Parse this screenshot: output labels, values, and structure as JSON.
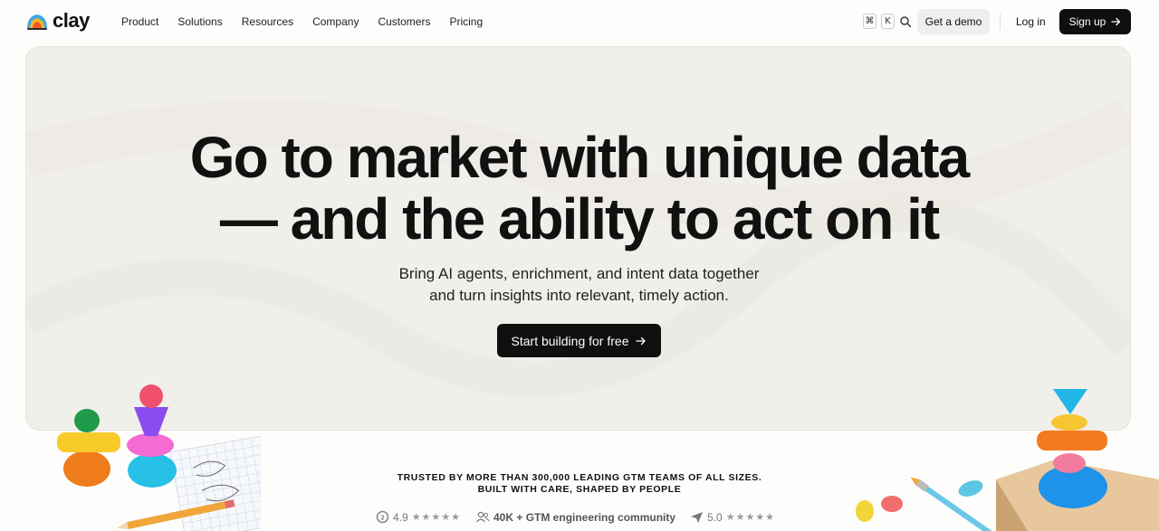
{
  "nav": {
    "logo_text": "clay",
    "menu": [
      "Product",
      "Solutions",
      "Resources",
      "Company",
      "Customers",
      "Pricing"
    ],
    "kbd_cmd": "⌘",
    "kbd_k": "K",
    "demo_label": "Get a demo",
    "login_label": "Log in",
    "signup_label": "Sign up"
  },
  "hero": {
    "headline_line1": "Go to market with unique data",
    "headline_line2": "— and the ability to act on it",
    "sub_line1": "Bring AI agents, enrichment, and intent data together",
    "sub_line2": "and turn insights into relevant, timely action.",
    "cta_label": "Start building for free"
  },
  "trust": {
    "line1": "TRUSTED BY MORE THAN 300,000 LEADING GTM TEAMS OF ALL SIZES.",
    "line2": "BUILT WITH CARE, SHAPED BY PEOPLE"
  },
  "ratings": {
    "g2_score": "4.9",
    "g2_stars": "★★★★★",
    "community": "40K + GTM engineering community",
    "capterra_score": "5.0",
    "capterra_stars": "★★★★★"
  },
  "colors": {
    "accent": "#0f0f0f",
    "hero_bg": "#f1efea"
  }
}
